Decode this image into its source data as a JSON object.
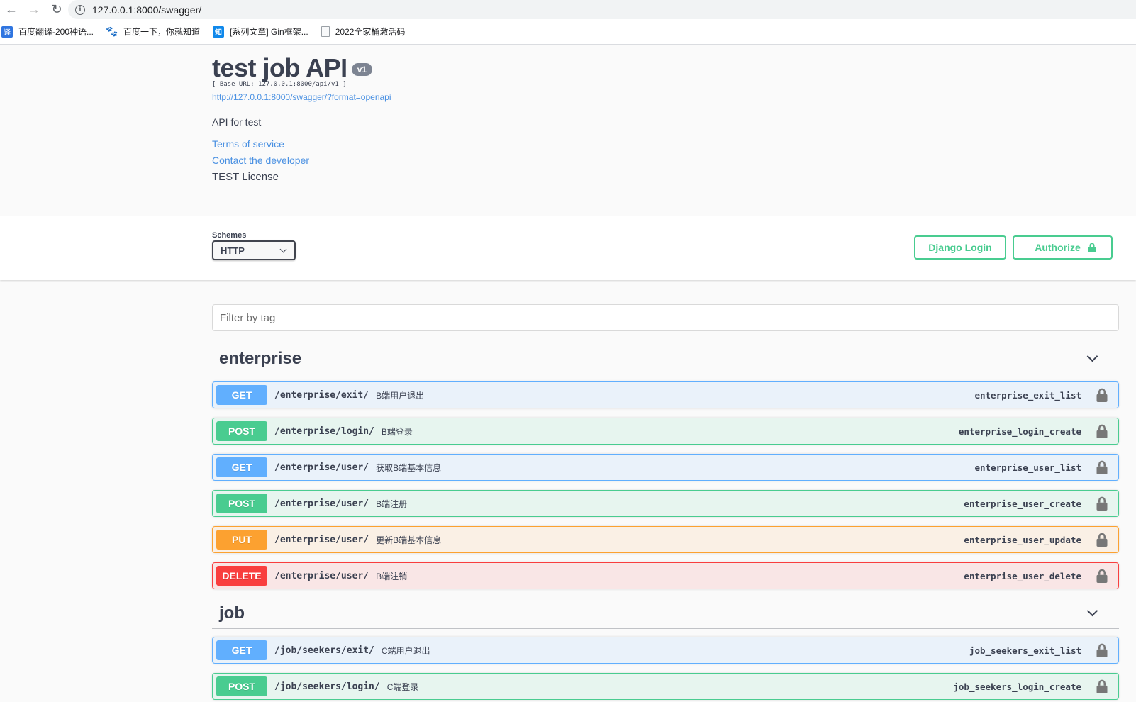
{
  "browser": {
    "url": "127.0.0.1:8000/swagger/",
    "back_icon": "←",
    "forward_icon": "→",
    "reload_icon": "↻",
    "info_icon": "i",
    "bookmarks": [
      {
        "icon": "译",
        "label": "百度翻译-200种语..."
      },
      {
        "icon": "🐾",
        "label": "百度一下，你就知道"
      },
      {
        "icon": "知",
        "label": "[系列文章] Gin框架..."
      },
      {
        "icon": "",
        "label": "2022全家桶激活码"
      }
    ]
  },
  "info": {
    "title": "test job API",
    "version": "v1",
    "base_url": "[ Base URL: 127.0.0.1:8000/api/v1 ]",
    "spec_link": "http://127.0.0.1:8000/swagger/?format=openapi",
    "description": "API for test",
    "terms_of_service": "Terms of service",
    "contact": "Contact the developer",
    "license": "TEST License"
  },
  "schemes": {
    "label": "Schemes",
    "selected": "HTTP"
  },
  "buttons": {
    "django_login": "Django Login",
    "authorize": "Authorize"
  },
  "filter": {
    "placeholder": "Filter by tag"
  },
  "tags": [
    {
      "name": "enterprise",
      "operations": [
        {
          "method": "GET",
          "path": "/enterprise/exit/",
          "summary": "B端用户退出",
          "operation_id": "enterprise_exit_list"
        },
        {
          "method": "POST",
          "path": "/enterprise/login/",
          "summary": "B端登录",
          "operation_id": "enterprise_login_create"
        },
        {
          "method": "GET",
          "path": "/enterprise/user/",
          "summary": "获取B端基本信息",
          "operation_id": "enterprise_user_list"
        },
        {
          "method": "POST",
          "path": "/enterprise/user/",
          "summary": "B端注册",
          "operation_id": "enterprise_user_create"
        },
        {
          "method": "PUT",
          "path": "/enterprise/user/",
          "summary": "更新B端基本信息",
          "operation_id": "enterprise_user_update"
        },
        {
          "method": "DELETE",
          "path": "/enterprise/user/",
          "summary": "B端注销",
          "operation_id": "enterprise_user_delete"
        }
      ]
    },
    {
      "name": "job",
      "operations": [
        {
          "method": "GET",
          "path": "/job/seekers/exit/",
          "summary": "C端用户退出",
          "operation_id": "job_seekers_exit_list"
        },
        {
          "method": "POST",
          "path": "/job/seekers/login/",
          "summary": "C端登录",
          "operation_id": "job_seekers_login_create"
        }
      ]
    }
  ],
  "colors": {
    "get": "#61affe",
    "post": "#49cc90",
    "put": "#fca130",
    "delete": "#f93e3e",
    "link": "#4990e2"
  }
}
